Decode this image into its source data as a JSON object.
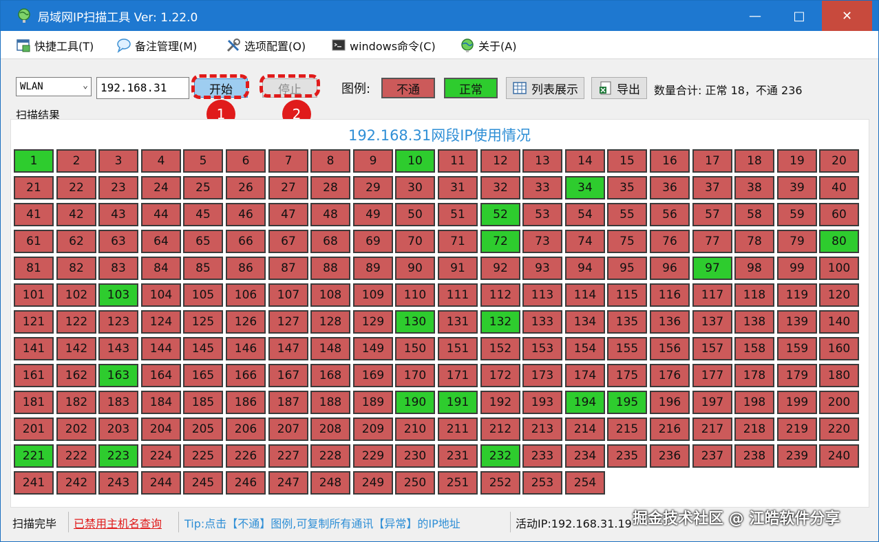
{
  "window": {
    "title": "局域网IP扫描工具 Ver: 1.22.0",
    "controls": {
      "minimize": "—",
      "maximize": "□",
      "close": "✕"
    }
  },
  "menu": [
    {
      "label": "快捷工具(T)",
      "icon": "tools-window-icon"
    },
    {
      "label": "备注管理(M)",
      "icon": "speech-bubble-icon"
    },
    {
      "label": "选项配置(O)",
      "icon": "wrench-screwdriver-icon"
    },
    {
      "label": "windows命令(C)",
      "icon": "terminal-icon"
    },
    {
      "label": "关于(A)",
      "icon": "globe-icon"
    }
  ],
  "toolbar": {
    "adapter_value": "WLAN",
    "ip_prefix": "192.168.31",
    "start_label": "开始",
    "stop_label": "停止",
    "legend_label": "图例:",
    "legend_fail": "不通",
    "legend_ok": "正常",
    "list_view_label": "列表展示",
    "export_label": "导出",
    "count_text": "数量合计: 正常 18，不通 236"
  },
  "annotations": {
    "marker_1": "1",
    "marker_2": "2"
  },
  "results": {
    "group_label": "扫描结果",
    "grid_title": "192.168.31网段IP使用情况",
    "total": 254,
    "columns": 20,
    "ok_hosts": [
      1,
      10,
      34,
      52,
      72,
      80,
      97,
      103,
      130,
      132,
      163,
      190,
      191,
      194,
      195,
      221,
      223,
      232
    ]
  },
  "status": {
    "state": "扫描完毕",
    "hostname_lookup": "已禁用主机名查询",
    "tip": "Tip:点击【不通】图例,可复制所有通讯【异常】的IP地址",
    "active_ip": "活动IP:192.168.31.19"
  },
  "watermark": "掘金技术社区 @ 江皓软件分享",
  "colors": {
    "ok": "#2ecc2e",
    "fail": "#cc5a5a",
    "title_bar": "#1e78d0",
    "accent": "#2f8fd6",
    "annotation": "#e01b1b"
  }
}
